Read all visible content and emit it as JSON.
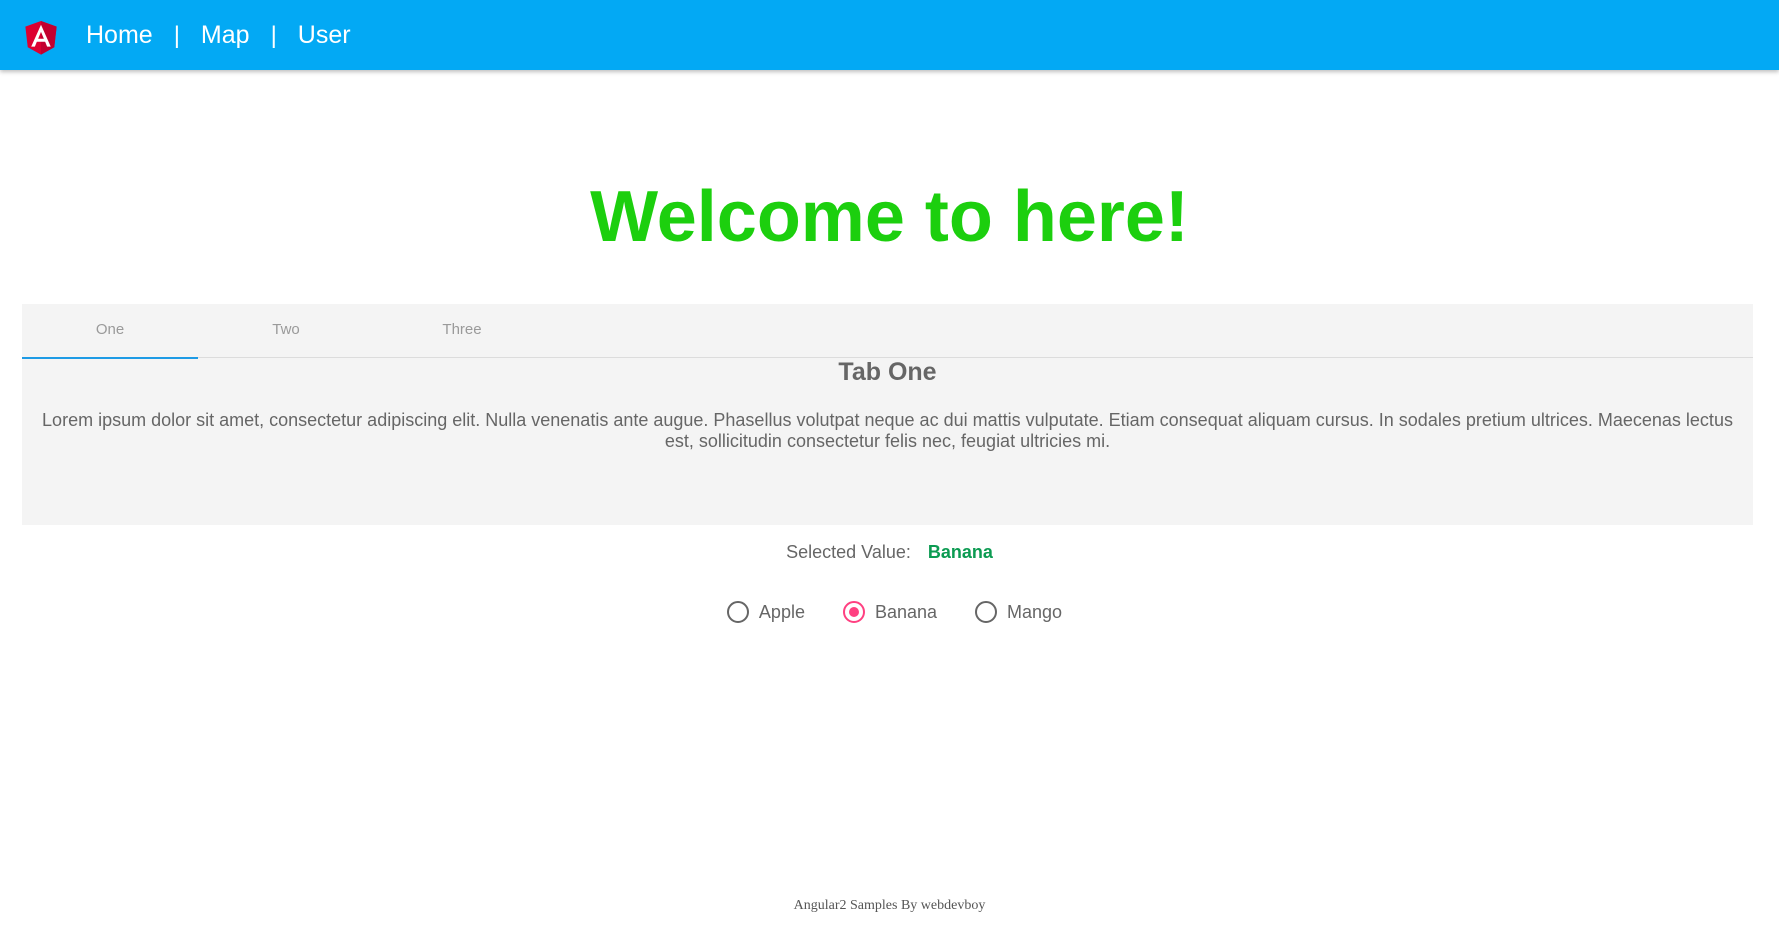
{
  "nav": {
    "logo_icon": "angular-logo-icon",
    "links": [
      "Home",
      "Map",
      "User"
    ],
    "separator": "|",
    "color": "#03a9f4"
  },
  "main": {
    "welcome": "Welcome to here!",
    "welcome_color": "#1ccf0e"
  },
  "tabs": {
    "items": [
      "One",
      "Two",
      "Three"
    ],
    "active": "One",
    "content_title": "Tab One",
    "content_text": "Lorem ipsum dolor sit amet, consectetur adipiscing elit. Nulla venenatis ante augue. Phasellus volutpat neque ac dui mattis vulputate. Etiam consequat aliquam cursus. In sodales pretium ultrices. Maecenas lectus est, sollicitudin consectetur felis nec, feugiat ultricies mi."
  },
  "selection": {
    "label": "Selected Value:",
    "value": "Banana",
    "options": [
      "Apple",
      "Banana",
      "Mango"
    ],
    "accent_color": "#ff4081"
  },
  "footer": {
    "text": "Angular2 Samples By webdevboy"
  }
}
